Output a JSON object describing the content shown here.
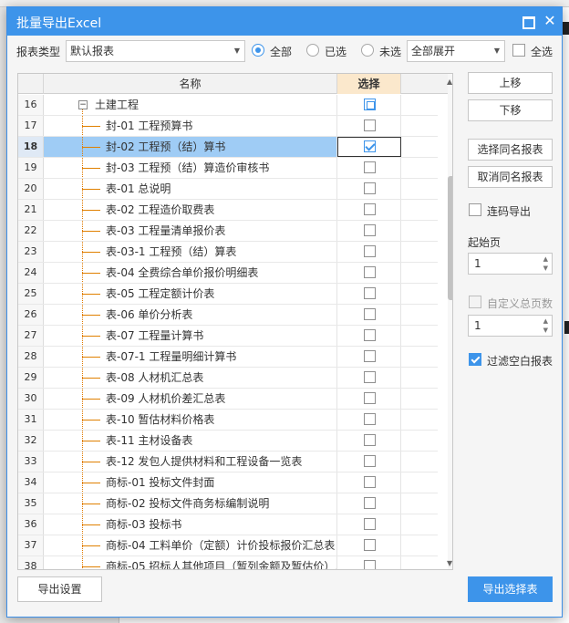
{
  "dialog": {
    "title": "批量导出Excel",
    "close_glyph": "✕"
  },
  "toolbar": {
    "report_type_label": "报表类型",
    "report_type_value": "默认报表",
    "radio_all": "全部",
    "radio_selected": "已选",
    "radio_unselected": "未选",
    "expand_value": "全部展开",
    "select_all_label": "全选"
  },
  "grid": {
    "col_name": "名称",
    "col_select": "选择",
    "rows": [
      {
        "num": "16",
        "name": "土建工程",
        "level": 0,
        "state": "partial"
      },
      {
        "num": "17",
        "name": "封-01 工程预算书",
        "level": 1,
        "state": "off"
      },
      {
        "num": "18",
        "name": "封-02 工程预（结）算书",
        "level": 1,
        "state": "on"
      },
      {
        "num": "19",
        "name": "封-03 工程预（结）算造价审核书",
        "level": 1,
        "state": "off"
      },
      {
        "num": "20",
        "name": "表-01 总说明",
        "level": 1,
        "state": "off"
      },
      {
        "num": "21",
        "name": "表-02 工程造价取费表",
        "level": 1,
        "state": "off"
      },
      {
        "num": "22",
        "name": "表-03 工程量清单报价表",
        "level": 1,
        "state": "off"
      },
      {
        "num": "23",
        "name": "表-03-1 工程预（结）算表",
        "level": 1,
        "state": "off"
      },
      {
        "num": "24",
        "name": "表-04 全费综合单价报价明细表",
        "level": 1,
        "state": "off"
      },
      {
        "num": "25",
        "name": "表-05 工程定额计价表",
        "level": 1,
        "state": "off"
      },
      {
        "num": "26",
        "name": "表-06  单价分析表",
        "level": 1,
        "state": "off"
      },
      {
        "num": "27",
        "name": "表-07 工程量计算书",
        "level": 1,
        "state": "off"
      },
      {
        "num": "28",
        "name": "表-07-1 工程量明细计算书",
        "level": 1,
        "state": "off"
      },
      {
        "num": "29",
        "name": "表-08 人材机汇总表",
        "level": 1,
        "state": "off"
      },
      {
        "num": "30",
        "name": "表-09 人材机价差汇总表",
        "level": 1,
        "state": "off"
      },
      {
        "num": "31",
        "name": "表-10 暂估材料价格表",
        "level": 1,
        "state": "off"
      },
      {
        "num": "32",
        "name": "表-11 主材设备表",
        "level": 1,
        "state": "off"
      },
      {
        "num": "33",
        "name": "表-12 发包人提供材料和工程设备一览表",
        "level": 1,
        "state": "off"
      },
      {
        "num": "34",
        "name": "商标-01 投标文件封面",
        "level": 1,
        "state": "off"
      },
      {
        "num": "35",
        "name": "商标-02 投标文件商务标编制说明",
        "level": 1,
        "state": "off"
      },
      {
        "num": "36",
        "name": "商标-03 投标书",
        "level": 1,
        "state": "off"
      },
      {
        "num": "37",
        "name": "商标-04 工料单价（定额）计价投标报价汇总表",
        "level": 1,
        "state": "off"
      },
      {
        "num": "38",
        "name": "商标-05 招标人其他项目（暂列金额及暂估价）…",
        "level": 1,
        "state": "off"
      }
    ]
  },
  "panel": {
    "move_up": "上移",
    "move_down": "下移",
    "select_same": "选择同名报表",
    "cancel_same": "取消同名报表",
    "continuous_export": "连码导出",
    "start_page_label": "起始页",
    "start_page_value": "1",
    "custom_total_pages": "自定义总页数",
    "total_pages_value": "1",
    "filter_blank": "过滤空白报表"
  },
  "footer": {
    "export_settings": "导出设置",
    "export_selected": "导出选择表"
  },
  "colors": {
    "accent": "#3d94ea",
    "select_header": "#fbe8cc",
    "row_highlight": "#9fccf5"
  }
}
